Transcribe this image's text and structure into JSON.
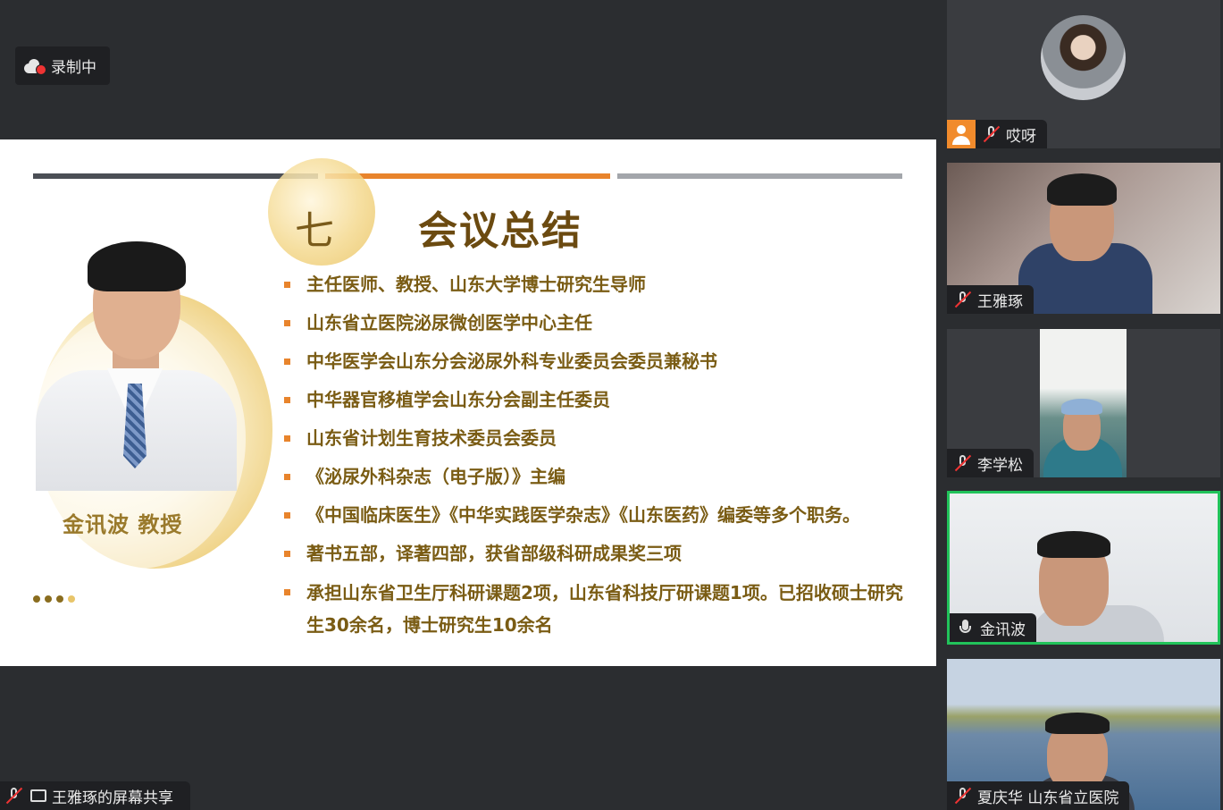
{
  "recording": {
    "label": "录制中",
    "icon": "cloud-record-icon",
    "dot_color": "#e33333"
  },
  "slide": {
    "number": "七",
    "title": "会议总结",
    "speaker_name": "金讯波 教授",
    "accent_colors": {
      "dark": "#4b4f55",
      "orange": "#e8842c",
      "gray": "#a3a6ab",
      "text": "#7a5c14"
    },
    "bullets": [
      "主任医师、教授、山东大学博士研究生导师",
      "山东省立医院泌尿微创医学中心主任",
      "中华医学会山东分会泌尿外科专业委员会委员兼秘书",
      "中华器官移植学会山东分会副主任委员",
      "山东省计划生育技术委员会委员",
      "《泌尿外科杂志（电子版）》主编",
      "《中国临床医生》《中华实践医学杂志》《山东医药》编委等多个职务。",
      "著书五部，译著四部，获省部级科研成果奖三项",
      "承担山东省卫生厅科研课题2项，山东省科技厅研课题1项。已招收硕士研究生30余名，博士研究生10余名"
    ],
    "pager_dots": [
      "#8a6d1f",
      "#8a6d1f",
      "#8a6d1f",
      "#e8c56a"
    ]
  },
  "share_bar": {
    "label": "王雅琢的屏幕共享",
    "mic_icon": "mic-muted-icon",
    "screen_icon": "screen-share-icon"
  },
  "participants": [
    {
      "name": "哎呀",
      "muted": true,
      "has_avatar_badge": true,
      "active": false
    },
    {
      "name": "王雅琢",
      "muted": true,
      "active": false
    },
    {
      "name": "李学松",
      "muted": true,
      "active": false
    },
    {
      "name": "金讯波",
      "muted": false,
      "active": true
    },
    {
      "name": "夏庆华 山东省立医院",
      "muted": true,
      "active": false
    }
  ],
  "colors": {
    "background": "#2b2d30",
    "label_bg": "#1f2023",
    "active_border": "#21c35a",
    "avatar_badge": "#f18b2c"
  }
}
